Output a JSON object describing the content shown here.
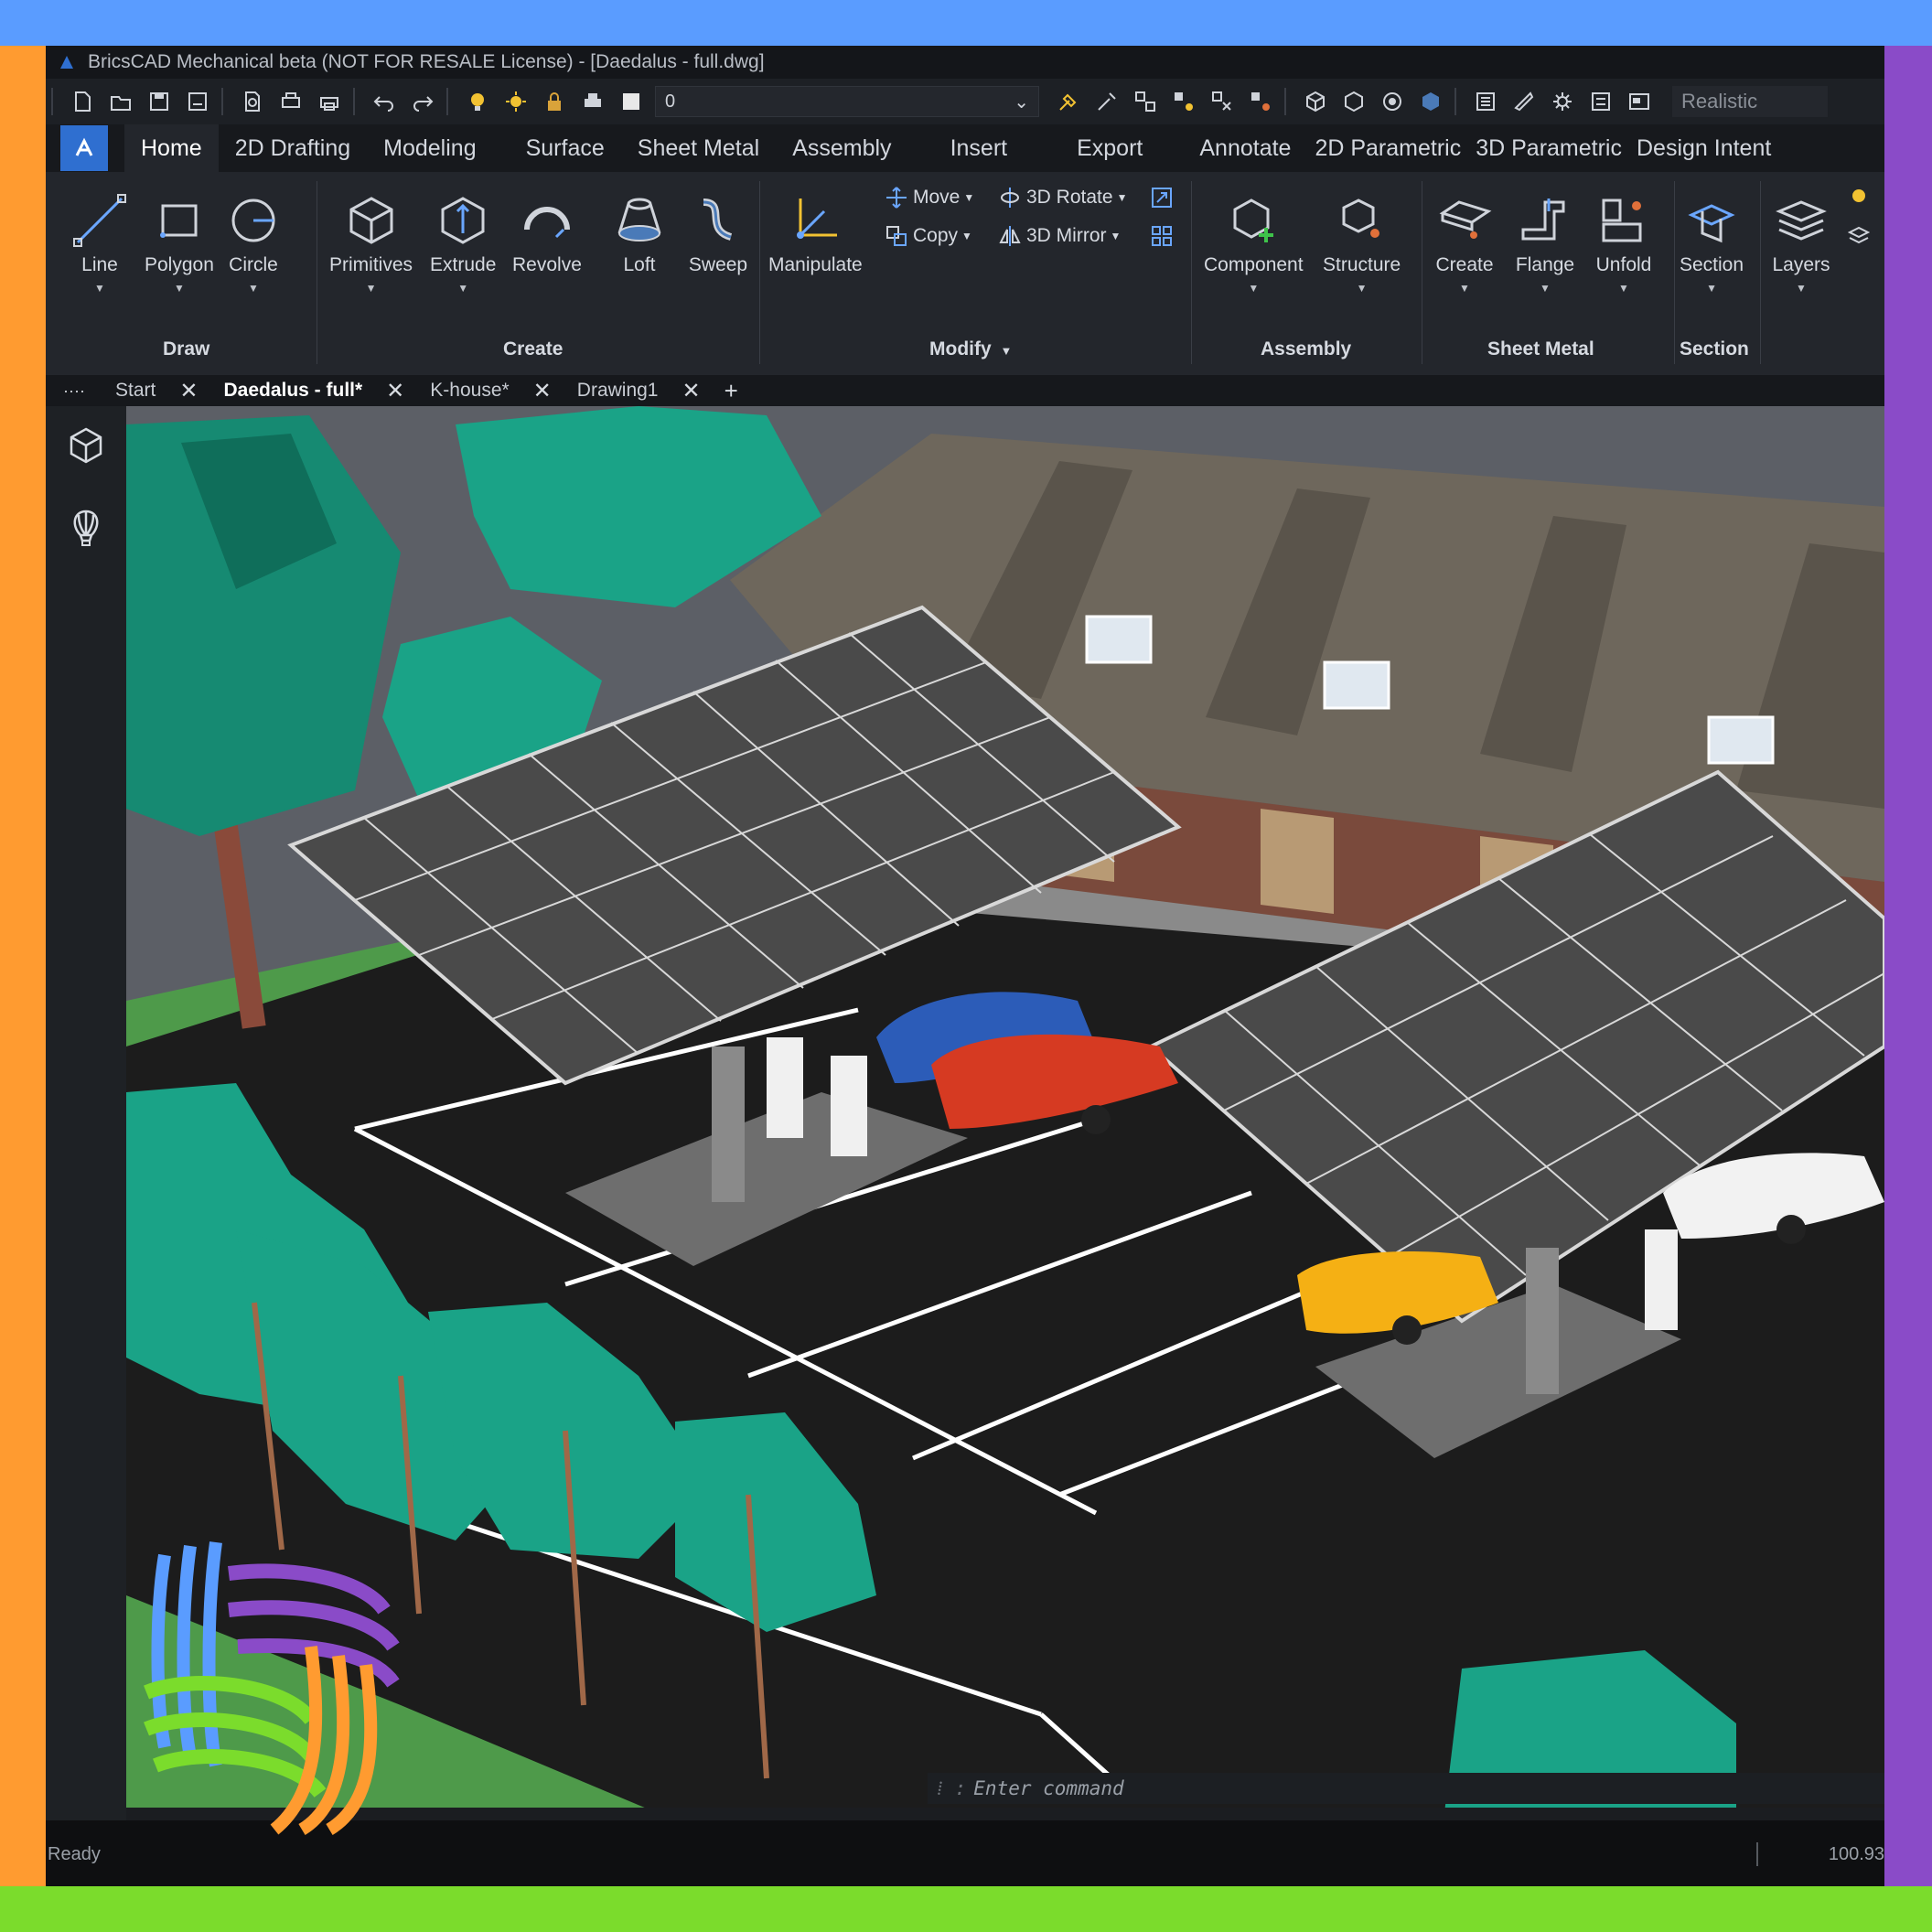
{
  "window": {
    "title": "BricsCAD Mechanical beta (NOT FOR RESALE License) - [Daedalus - full.dwg]"
  },
  "quickbar": {
    "layer_value": "0",
    "visual_style": "Realistic"
  },
  "ribbon_tabs": [
    "Home",
    "2D Drafting",
    "Modeling",
    "Surface",
    "Sheet Metal",
    "Assembly",
    "Insert",
    "Export",
    "Annotate",
    "2D Parametric",
    "3D Parametric",
    "Design Intent"
  ],
  "ribbon": {
    "tools": {
      "line": "Line",
      "polygon": "Polygon",
      "circle": "Circle",
      "primitives": "Primitives",
      "extrude": "Extrude",
      "revolve": "Revolve",
      "loft": "Loft",
      "sweep": "Sweep",
      "manipulate": "Manipulate",
      "move": "Move",
      "copy": "Copy",
      "rotate3d": "3D Rotate",
      "mirror3d": "3D Mirror",
      "component": "Component",
      "structure": "Structure",
      "create": "Create",
      "flange": "Flange",
      "unfold": "Unfold",
      "section": "Section",
      "layers": "Layers"
    },
    "groups": {
      "draw": "Draw",
      "create": "Create",
      "modify": "Modify",
      "assembly": "Assembly",
      "sheet_metal": "Sheet Metal",
      "section": "Section"
    }
  },
  "doc_tabs": [
    {
      "label": "Start"
    },
    {
      "label": "Daedalus - full*"
    },
    {
      "label": "K-house*"
    },
    {
      "label": "Drawing1"
    }
  ],
  "command_line": {
    "placeholder": "Enter command"
  },
  "status": {
    "state": "Ready",
    "coordinate": "100.93"
  },
  "colors": {
    "frame_blue": "#5a9cff",
    "frame_orange": "#ff9b30",
    "frame_purple": "#8a4bc8",
    "frame_green": "#7bdc2c",
    "app_bg": "#1b1d21",
    "accent": "#2f6fd0",
    "tree": "#1aa387",
    "asphalt": "#1a1a1a",
    "roof": "#6e675c",
    "brick": "#7a4a3c"
  }
}
